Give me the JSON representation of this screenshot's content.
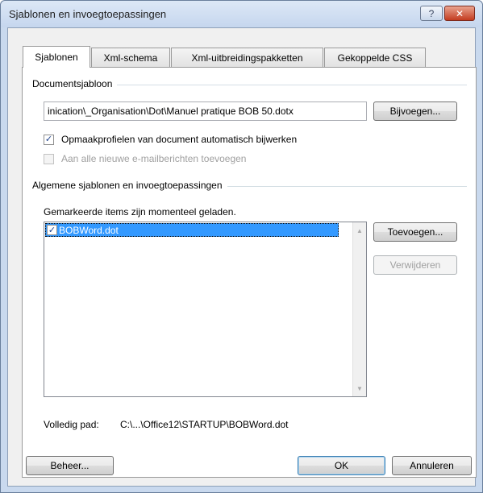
{
  "window": {
    "title": "Sjablonen en invoegtoepassingen",
    "help_glyph": "?",
    "close_glyph": "✕"
  },
  "tabs": [
    {
      "label": "Sjablonen",
      "active": true
    },
    {
      "label": "Xml-schema",
      "active": false
    },
    {
      "label": "Xml-uitbreidingspakketten",
      "active": false
    },
    {
      "label": "Gekoppelde CSS",
      "active": false
    }
  ],
  "document_template": {
    "group_label": "Documentsjabloon",
    "path_value": "inication\\_Organisation\\Dot\\Manuel pratique BOB 50.dotx",
    "attach_button": "Bijvoegen...",
    "auto_update": {
      "label": "Opmaakprofielen van document automatisch bijwerken",
      "checked": true,
      "check_glyph": "✓"
    },
    "attach_to_email": {
      "label": "Aan alle nieuwe e-mailberichten toevoegen",
      "checked": false,
      "enabled": false
    }
  },
  "global_templates": {
    "group_label": "Algemene sjablonen en invoegtoepassingen",
    "loaded_caption": "Gemarkeerde items zijn momenteel geladen.",
    "items": [
      {
        "label": "BOBWord.dot",
        "checked": true,
        "selected": true,
        "check_glyph": "✓"
      }
    ],
    "add_button": "Toevoegen...",
    "remove_button": "Verwijderen",
    "full_path_label": "Volledig pad:",
    "full_path_value": "C:\\...\\Office12\\STARTUP\\BOBWord.dot"
  },
  "footer": {
    "organizer_button": "Beheer...",
    "ok_button": "OK",
    "cancel_button": "Annuleren"
  },
  "icons": {
    "scroll_up": "▲",
    "scroll_down": "▼"
  }
}
